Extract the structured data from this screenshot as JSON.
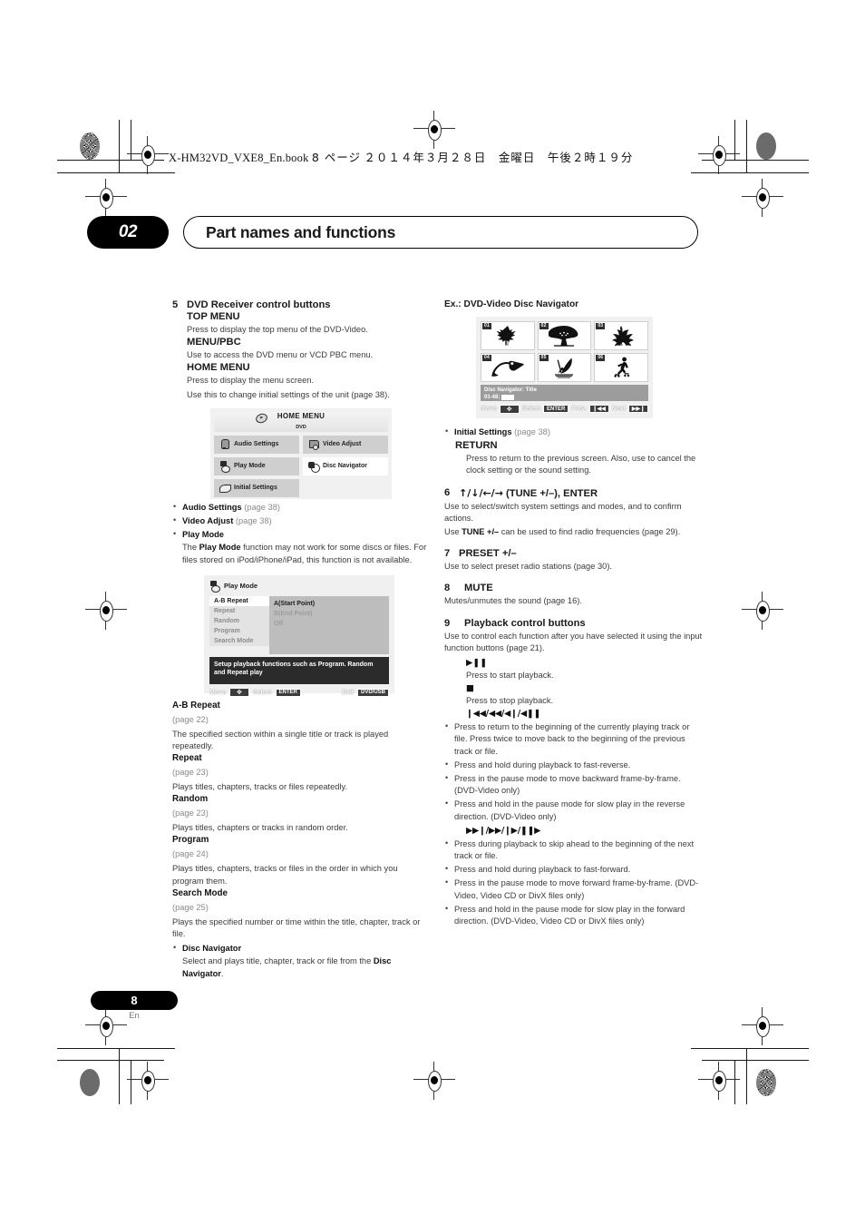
{
  "header": {
    "book_line": "X-HM32VD_VXE8_En.book",
    "book_page": "8 ページ",
    "book_date": "２０１４年３月２８日　金曜日　午後２時１９分"
  },
  "chapter": {
    "number": "02",
    "title": "Part names and functions"
  },
  "footer": {
    "page": "8",
    "lang": "En"
  },
  "left_column": {
    "item5": {
      "num": "5",
      "title": "DVD Receiver control buttons",
      "top_menu": {
        "label": "TOP MENU",
        "desc": "Press to display the top menu of the DVD-Video."
      },
      "menu_pbc": {
        "label": "MENU/PBC",
        "desc": "Use to access the DVD menu or VCD PBC menu."
      },
      "home_menu": {
        "label": "HOME MENU",
        "desc1": "Press to display the menu screen.",
        "desc2": "Use this to change initial settings of the unit (page 38)."
      }
    },
    "home_menu_osd": {
      "title": "HOME MENU",
      "subtitle": "DVD",
      "cells": [
        {
          "label": "Audio Settings",
          "icon": "speaker-icon",
          "selected": false
        },
        {
          "label": "Video Adjust",
          "icon": "monitor-icon",
          "selected": false
        },
        {
          "label": "Play Mode",
          "icon": "play-mode-icon",
          "selected": false
        },
        {
          "label": "Disc Navigator",
          "icon": "disc-navigator-icon",
          "selected": true
        },
        {
          "label": "Initial Settings",
          "icon": "settings-icon",
          "selected": false
        }
      ]
    },
    "menu_bullets": [
      {
        "term": "Audio Settings",
        "page": "(page 38)"
      },
      {
        "term": "Video Adjust",
        "page": "(page 38)"
      },
      {
        "term": "Play Mode",
        "page": ""
      }
    ],
    "play_mode_note_pre": "The ",
    "play_mode_note_bold": "Play Mode",
    "play_mode_note_post": " function may not work for some discs or files. For files stored on iPod/iPhone/iPad, this function is not available.",
    "play_mode_osd": {
      "header_label": "Play Mode",
      "items": [
        {
          "label": "A-B Repeat",
          "selected": true
        },
        {
          "label": "Repeat",
          "selected": false
        },
        {
          "label": "Random",
          "selected": false
        },
        {
          "label": "Program",
          "selected": false
        },
        {
          "label": "Search Mode",
          "selected": false
        }
      ],
      "options": [
        {
          "label": "A(Start Point)",
          "active": true
        },
        {
          "label": "B(End Point)",
          "active": false
        },
        {
          "label": "Off",
          "active": false
        }
      ],
      "message": "Setup playback functions such as Program. Random and Repeat play",
      "bar": {
        "move_label": "Move",
        "move_key": "d-pad",
        "select_label": "Select",
        "select_key": "ENTER",
        "exit_label": "Exit",
        "exit_key": "DVD/USB"
      }
    },
    "definitions": [
      {
        "term": "A-B Repeat",
        "page": "(page 22)",
        "desc": "The specified section within a single title or track is played repeatedly."
      },
      {
        "term": "Repeat",
        "page": "(page 23)",
        "desc": "Plays titles, chapters, tracks or files repeatedly."
      },
      {
        "term": "Random",
        "page": "(page 23)",
        "desc": "Plays titles, chapters or tracks in random order."
      },
      {
        "term": "Program",
        "page": "(page 24)",
        "desc": "Plays titles, chapters, tracks or files in the order in which you program them."
      },
      {
        "term": "Search Mode",
        "page": "(page 25)",
        "desc": "Plays the specified number or time within the title, chapter, track or file."
      }
    ],
    "disc_navigator_bullet": {
      "term": "Disc Navigator",
      "desc_pre": "Select and plays title, chapter, track or file from the ",
      "desc_bold": "Disc Navigator",
      "desc_post": "."
    }
  },
  "right_column": {
    "example_label": "Ex.: DVD-Video Disc Navigator",
    "disc_navigator_osd": {
      "thumbs": [
        {
          "num": "01",
          "icon": "maple-leaf-icon"
        },
        {
          "num": "02",
          "icon": "tree-icon"
        },
        {
          "num": "03",
          "icon": "lily-flower-icon"
        },
        {
          "num": "04",
          "icon": "toucan-bird-icon"
        },
        {
          "num": "05",
          "icon": "windsurfer-icon"
        },
        {
          "num": "06",
          "icon": "inline-skater-icon"
        }
      ],
      "status_line1": "Disc Navigator: Title",
      "status_line2": "01-48:",
      "bar": {
        "move_label": "Move",
        "move_key": "d-pad",
        "select_label": "Select",
        "select_key": "ENTER",
        "prev_label": "Prev.",
        "prev_key": "prev-icon",
        "next_label": "Next",
        "next_key": "next-icon"
      }
    },
    "initial_settings_bullet": {
      "term": "Initial Settings",
      "page": "(page 38)"
    },
    "return": {
      "label": "RETURN",
      "desc": "Press to return to the previous screen. Also, use to cancel the clock setting or the sound setting."
    },
    "item6": {
      "num": "6",
      "arrows": "↑/↓/←/→",
      "title": "(TUNE +/–), ENTER",
      "desc1": "Use to select/switch system settings and modes, and to confirm actions.",
      "desc2_pre": "Use ",
      "desc2_bold": "TUNE +/–",
      "desc2_post": " can be used to find radio frequencies (page 29)."
    },
    "item7": {
      "num": "7",
      "title": "PRESET +/–",
      "desc": "Use to select preset radio stations (page 30)."
    },
    "item8": {
      "num": "8",
      "title": "MUTE",
      "desc": "Mutes/unmutes the sound (page 16)."
    },
    "item9": {
      "num": "9",
      "title": "Playback control buttons",
      "desc": "Use to control each function after you have selected it using the input function buttons (page 21).",
      "play_glyph": "▶❚❚",
      "play_desc": "Press to start playback.",
      "stop_glyph": "■",
      "stop_desc": "Press to stop playback.",
      "rev_glyph": "❙◀◀/◀◀/◀❙/◀❚❚",
      "rev_bullets": [
        "Press to return to the beginning of the currently playing track or file. Press twice to move back to the beginning of the previous track or file.",
        "Press and hold during playback to fast-reverse.",
        "Press in the pause mode to move backward frame-by-frame. (DVD-Video only)",
        "Press and hold in the pause mode for slow play in the reverse direction. (DVD-Video only)"
      ],
      "fwd_glyph": "▶▶❙/▶▶/❙▶/❚❚▶",
      "fwd_bullets": [
        "Press during playback to skip ahead to the beginning of the next track or file.",
        "Press and hold during playback to fast-forward.",
        "Press in the pause mode to move forward frame-by-frame. (DVD-Video, Video CD or DivX files only)",
        "Press and hold in the pause mode for slow play in the forward direction. (DVD-Video, Video CD or DivX files only)"
      ]
    }
  }
}
